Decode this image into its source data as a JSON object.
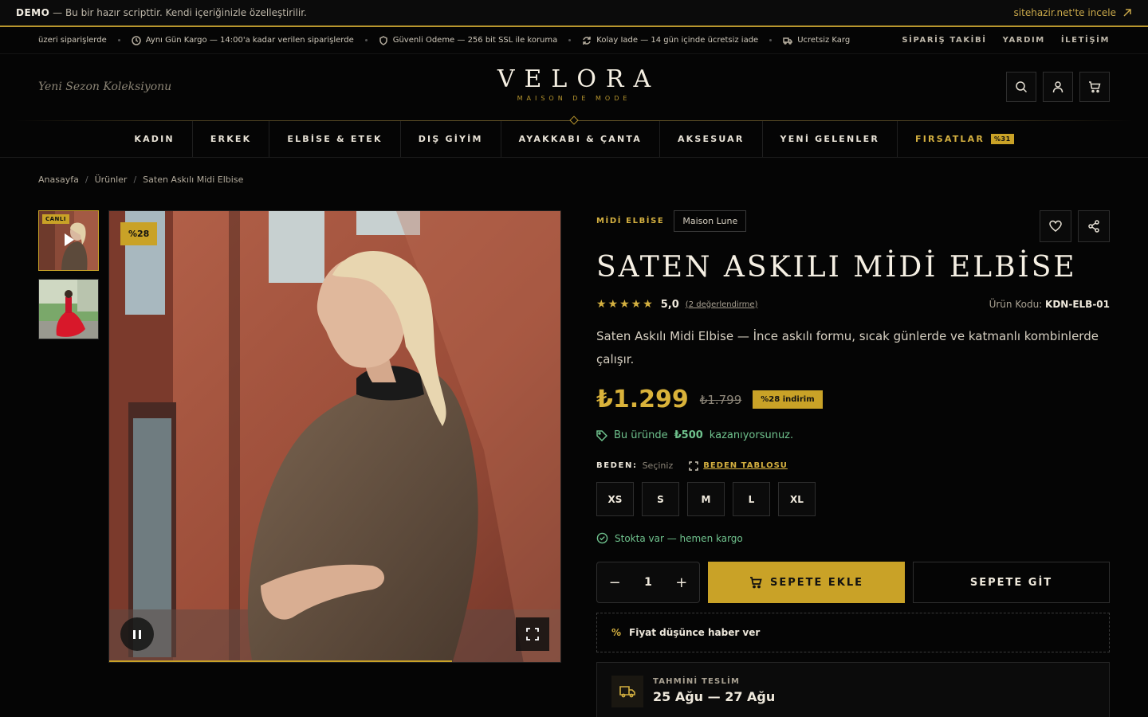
{
  "demo_bar": {
    "label": "DEMO",
    "text": " — Bu bir hazır scripttir. Kendi içeriğinizle özelleştirilir.",
    "link": "sitehazir.net'te incele"
  },
  "announce": {
    "items": [
      "üzeri siparişlerde",
      "Aynı Gün Kargo — 14:00'a kadar verilen siparişlerde",
      "Güvenli Ödeme — 256 bit SSL ile koruma",
      "Kolay İade — 14 gün içinde ücretsiz iade",
      "Ücretsiz Karg"
    ],
    "links": [
      "SİPARİŞ TAKİBİ",
      "YARDIM",
      "İLETİŞİM"
    ]
  },
  "header": {
    "tagline": "Yeni Sezon Koleksiyonu",
    "logo": "VELORA",
    "logo_sub": "MAISON DE MODE"
  },
  "nav": {
    "items": [
      "KADIN",
      "ERKEK",
      "ELBİSE & ETEK",
      "DIŞ GİYİM",
      "AYAKKABI & ÇANTA",
      "AKSESUAR",
      "YENİ GELENLER"
    ],
    "deals_label": "FIRSATLAR",
    "deals_badge": "%31"
  },
  "breadcrumb": [
    "Anasayfa",
    "Ürünler",
    "Saten Askılı Midi Elbise"
  ],
  "gallery": {
    "live_label": "CANLI",
    "discount_badge": "%28",
    "video_progress": 0.76
  },
  "product": {
    "category": "MİDİ ELBİSE",
    "brand": "Maison Lune",
    "title": "SATEN ASKILI MİDİ ELBİSE",
    "stars": "★★★★★",
    "rating": "5,0",
    "reviews": "(2 değerlendirme)",
    "sku_label": "Ürün Kodu:",
    "sku": "KDN-ELB-01",
    "description": "Saten Askılı Midi Elbise — İnce askılı formu, sıcak günlerde ve katmanlı kombinlerde çalışır.",
    "price": "₺1.299",
    "old_price": "₺1.799",
    "discount": "%28 indirim",
    "points_pre": "Bu üründe",
    "points_val": "₺500",
    "points_post": "kazanıyorsunuz."
  },
  "size": {
    "label": "BEDEN:",
    "hint": "Seçiniz",
    "chart_link": "BEDEN TABLOSU",
    "options": [
      "XS",
      "S",
      "M",
      "L",
      "XL"
    ]
  },
  "stock": "Stokta var — hemen kargo",
  "cart": {
    "minus": "−",
    "qty": "1",
    "plus": "+",
    "add_label": "SEPETE EKLE",
    "go_label": "SEPETE GİT"
  },
  "price_alert": {
    "icon": "%",
    "label": "Fiyat düşünce haber ver"
  },
  "delivery": {
    "label": "TAHMİNİ TESLİM",
    "date": "25 Ağu — 27 Ağu"
  },
  "colors": {
    "accent": "#c9a227",
    "background": "#050505",
    "success": "#6fc28d"
  }
}
